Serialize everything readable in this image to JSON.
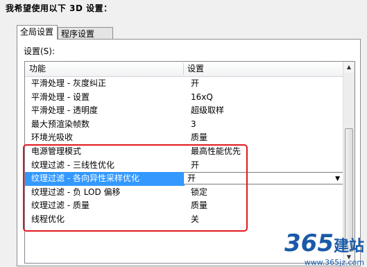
{
  "heading": "我希望使用以下 3D 设置：",
  "tabs": [
    {
      "label": "全局设置",
      "active": true
    },
    {
      "label": "程序设置",
      "active": false
    }
  ],
  "settings_label": "设置(S):",
  "table": {
    "columns": [
      "功能",
      "设置"
    ],
    "rows": [
      {
        "feature": "平滑处理 - 灰度纠正",
        "value": "开"
      },
      {
        "feature": "平滑处理 - 设置",
        "value": "16xQ"
      },
      {
        "feature": "平滑处理 - 透明度",
        "value": "超级取样"
      },
      {
        "feature": "最大预渲染帧数",
        "value": "3"
      },
      {
        "feature": "环境光吸收",
        "value": "质量"
      },
      {
        "feature": "电源管理模式",
        "value": "最高性能优先"
      },
      {
        "feature": "纹理过滤 - 三线性优化",
        "value": "开"
      },
      {
        "feature": "纹理过滤 - 各向异性采样优化",
        "value": "开",
        "selected": true
      },
      {
        "feature": "纹理过滤 - 负 LOD 偏移",
        "value": "锁定"
      },
      {
        "feature": "纹理过滤 - 质量",
        "value": "质量"
      },
      {
        "feature": "线程优化",
        "value": "关"
      }
    ]
  },
  "icons": {
    "scroll_up": "triangle-up-icon",
    "scroll_down": "triangle-down-icon",
    "dropdown": "chevron-down-icon"
  },
  "colors": {
    "selection": "#3399ff",
    "highlight_border": "#e0191d"
  },
  "watermark": {
    "logo": "365",
    "logo_suffix": "建站",
    "url": "www.365jz.com"
  }
}
